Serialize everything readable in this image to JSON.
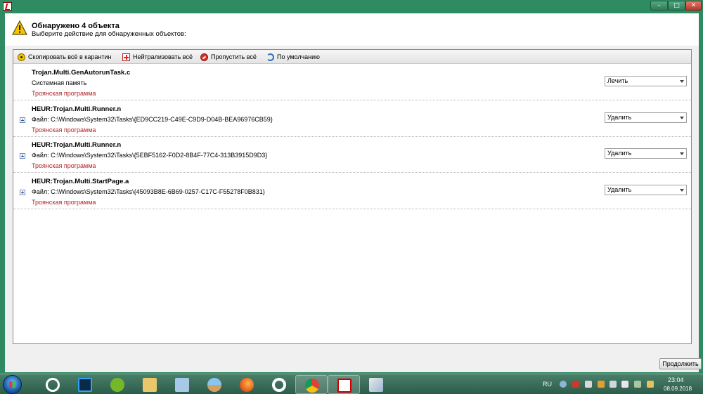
{
  "window": {
    "buttons": [
      "–",
      "□",
      "✕"
    ]
  },
  "header": {
    "title": "Обнаружено 4 объекта",
    "subtitle": "Выберите действие для обнаруженных объектов:",
    "icon": "warning-icon"
  },
  "toolbar": {
    "quarantine_label": "Скопировать всё в карантин",
    "neutralize_label": "Нейтрализовать всё",
    "skip_label": "Пропустить всё",
    "default_label": "По умолчанию"
  },
  "threats": [
    {
      "name": "Trojan.Multi.GenAutorunTask.c",
      "location": "Системная память",
      "type": "Троянская программа",
      "action": "Лечить"
    },
    {
      "name": "HEUR:Trojan.Multi.Runner.n",
      "location": "Файл: C:\\Windows\\System32\\Tasks\\{ED9CC219-C49E-C9D9-D04B-BEA96976CB59}",
      "type": "Троянская программа",
      "action": "Удалить"
    },
    {
      "name": "HEUR:Trojan.Multi.Runner.n",
      "location": "Файл: C:\\Windows\\System32\\Tasks\\{5EBF5162-F0D2-8B4F-77C4-313B3915D9D3}",
      "type": "Троянская программа",
      "action": "Удалить"
    },
    {
      "name": "HEUR:Trojan.Multi.StartPage.a",
      "location": "Файл: C:\\Windows\\System32\\Tasks\\{45093B8E-6B69-0257-C17C-F55278F0B831}",
      "type": "Троянская программа",
      "action": "Удалить"
    }
  ],
  "footer": {
    "continue_label": "Продолжить"
  },
  "taskbar": {
    "apps": [
      "opera-gx-icon",
      "photoshop-icon",
      "utorrent-icon",
      "file-explorer-icon",
      "notes-icon",
      "weather-icon",
      "firefox-icon",
      "opera-icon",
      "chrome-icon",
      "kaspersky-icon",
      "paint-icon"
    ],
    "lang": "RU",
    "time": "23:04",
    "date": "08.09.2018"
  },
  "colors": {
    "window_frame": "#2f8a62",
    "threat_type": "#b0242a",
    "taskbar": "#3c6e5a"
  }
}
